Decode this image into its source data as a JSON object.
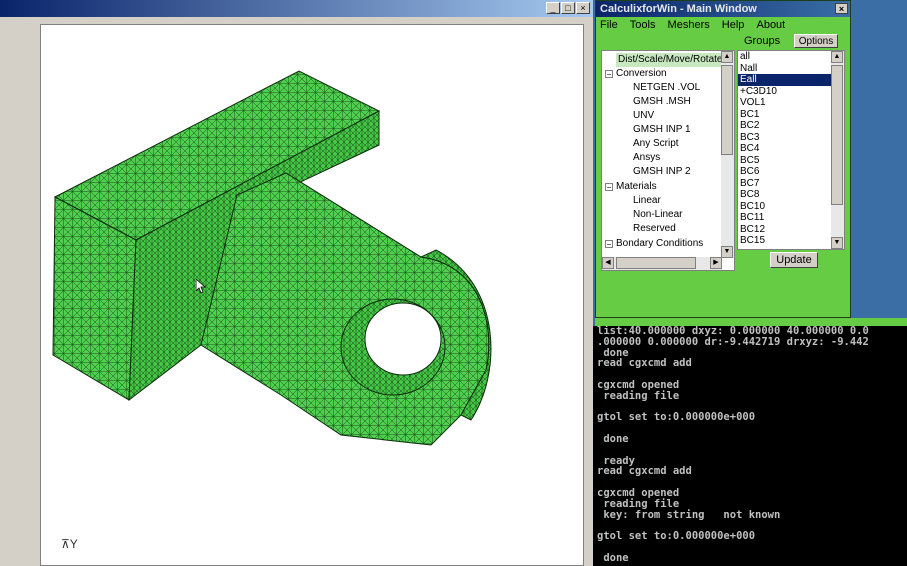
{
  "viewer": {
    "buttons": {
      "minimize": "_",
      "maximize": "□",
      "close": "×"
    },
    "axis_label": "Y"
  },
  "calculix_window": {
    "title": "CalculixforWin - Main Window",
    "close": "×",
    "menu": [
      "File",
      "Tools",
      "Meshers",
      "Help",
      "About"
    ],
    "groups_label": "Groups",
    "options_button": "Options",
    "update_button": "Update",
    "tree": {
      "selected": "Dist/Scale/Move/Rotate",
      "conversion": "Conversion",
      "conversion_items": [
        "NETGEN .VOL",
        "GMSH .MSH",
        "UNV",
        "GMSH INP 1",
        "Any Script",
        "Ansys",
        "GMSH INP 2"
      ],
      "materials": "Materials",
      "materials_items": [
        "Linear",
        "Non-Linear",
        "Reserved"
      ],
      "boundary": "Bondary Conditions"
    },
    "groups": [
      "all",
      "Nall",
      "Eall",
      "+C3D10",
      "VOL1",
      "BC1",
      "BC2",
      "BC3",
      "BC4",
      "BC5",
      "BC6",
      "BC7",
      "BC8",
      "BC10",
      "BC11",
      "BC12",
      "BC15"
    ],
    "selected_group": "Eall"
  },
  "console": {
    "lines": [
      "list:40.000000 dxyz: 0.000000 40.000000 0.0",
      ".000000 0.000000 dr:-9.442719 drxyz: -9.442",
      " done",
      "read cgxcmd add",
      "",
      "cgxcmd opened",
      " reading file",
      "",
      "gtol set to:0.000000e+000",
      "",
      " done",
      "",
      " ready",
      "read cgxcmd add",
      "",
      "cgxcmd opened",
      " reading file",
      " key: from string   not known",
      "",
      "gtol set to:0.000000e+000",
      "",
      " done"
    ]
  },
  "colors": {
    "mesh_fill": "#4fd14f",
    "panel_green": "#66cc44",
    "console_bg": "#000000"
  }
}
